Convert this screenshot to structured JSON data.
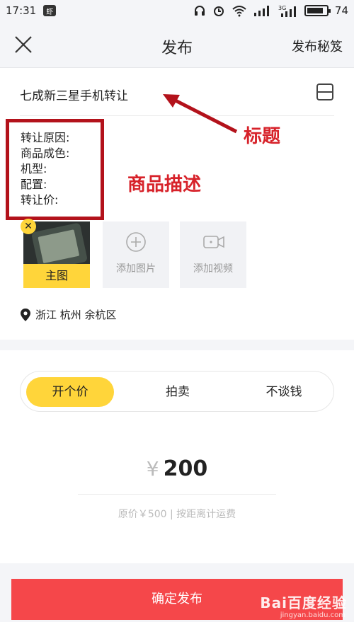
{
  "status_bar": {
    "time": "17:31",
    "app_badge": "虾",
    "network": "3G",
    "battery": "74"
  },
  "nav": {
    "title": "发布",
    "tips_link": "发布秘笈"
  },
  "listing": {
    "title": "七成新三星手机转让",
    "description_lines": [
      "转让原因:",
      "商品成色:",
      "机型:",
      "配置:",
      "转让价:"
    ]
  },
  "annotations": {
    "title_label": "标题",
    "desc_label": "商品描述"
  },
  "media": {
    "main_photo_label": "主图",
    "add_photo_label": "添加图片",
    "add_video_label": "添加视频"
  },
  "location": "浙江 杭州 余杭区",
  "pricing_modes": {
    "options": [
      "开个价",
      "拍卖",
      "不谈钱"
    ],
    "selected": "开个价"
  },
  "price": {
    "currency": "¥",
    "amount": "200",
    "subtext": "原价￥500 | 按距离计运费"
  },
  "actions": {
    "publish_label": "确定发布"
  },
  "watermark": {
    "text": "Bai百度经验",
    "sub": "jingyan.baidu.com"
  },
  "colors": {
    "accent_yellow": "#ffd53a",
    "publish_red": "#f5474a",
    "annotation_red": "#d7222a"
  }
}
